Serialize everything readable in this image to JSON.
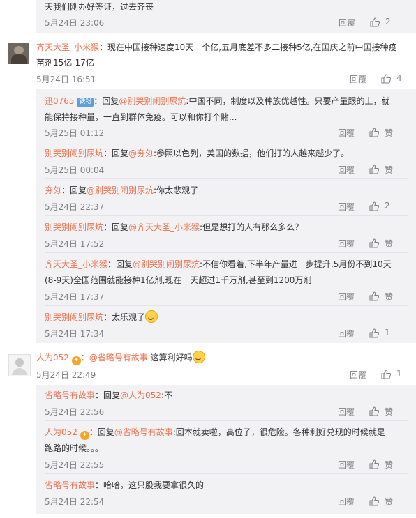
{
  "reply_label": "回覆",
  "top": {
    "text": "天我们刚办好签证，过去齐丧",
    "time": "5月24日 23:06",
    "likes": "2"
  },
  "c1": {
    "name": "齐天大圣_小米猴",
    "text1": "：现在中国接种速度10天一个亿,五月底差不多二接种5亿,在国庆之前中国接种疫",
    "text2": "苗剂15亿-17亿",
    "time": "5月24日 16:51",
    "likes": "4",
    "replies": [
      {
        "name": "迅0765",
        "badge": "铁粉",
        "prefix": "：回复",
        "at": "@别哭别闹别尿炕",
        "text1": ":中国不同，制度以及种族优越性。只要产量跟的上，就",
        "text2": "能保持接种量，一直到群体免疫。可以和你打个赌...",
        "time": "5月25日 01:12",
        "likes": "赞"
      },
      {
        "name": "别哭别闹别尿炕",
        "prefix": "：回复",
        "at": "@夯匁",
        "text1": ":参照以色列，美国的数据，他们打的人越来越少了。",
        "time": "5月25日 00:04",
        "likes": "赞"
      },
      {
        "name": "夯匁",
        "prefix": "：回复",
        "at": "@别哭别闹别尿炕",
        "text1": ":你太悲观了",
        "time": "5月24日 22:37",
        "likes": "2"
      },
      {
        "name": "别哭别闹别尿炕",
        "prefix": "：回复",
        "at": "@齐天大圣_小米猴",
        "text1": ":但是想打的人有那么多么？",
        "time": "5月24日 17:52",
        "likes": "赞"
      },
      {
        "name": "齐天大圣_小米猴",
        "prefix": "：回复",
        "at": "@别哭别闹别尿炕",
        "text1": ":不信你看着,下半年产量进一步提升,5月份不到10天",
        "text2": "(8-9天)全国范围就能接种1亿剂,现在一天超过1千万剂,甚至到1200万剂",
        "time": "5月24日 17:37",
        "likes": "赞"
      },
      {
        "name": "别哭别闹别尿炕",
        "prefix": "：太乐观了",
        "time": "5月24日 17:34",
        "likes": "1"
      }
    ]
  },
  "c2": {
    "name": "人为052",
    "prefix": "：",
    "at": "@省略号有故事",
    "text": " 这算利好吗",
    "time": "5月24日 22:49",
    "likes": "1",
    "replies": [
      {
        "name": "省略号有故事",
        "prefix": "：回复",
        "at": "@人为052",
        "text1": ":不",
        "time": "5月24日 22:56",
        "likes": "赞"
      },
      {
        "name": "人为052",
        "prefix": "：回复",
        "at": "@省略号有故事",
        "text1": ":回本就卖啦，高位了，很危险。各种利好兑现的时候就是",
        "text2": "跑路的时候。。。",
        "time": "5月24日 22:55",
        "likes": "赞"
      },
      {
        "name": "省略号有故事",
        "prefix": "：哈哈，这只股我要拿很久的",
        "time": "5月24日 22:54",
        "likes": "赞"
      }
    ]
  }
}
